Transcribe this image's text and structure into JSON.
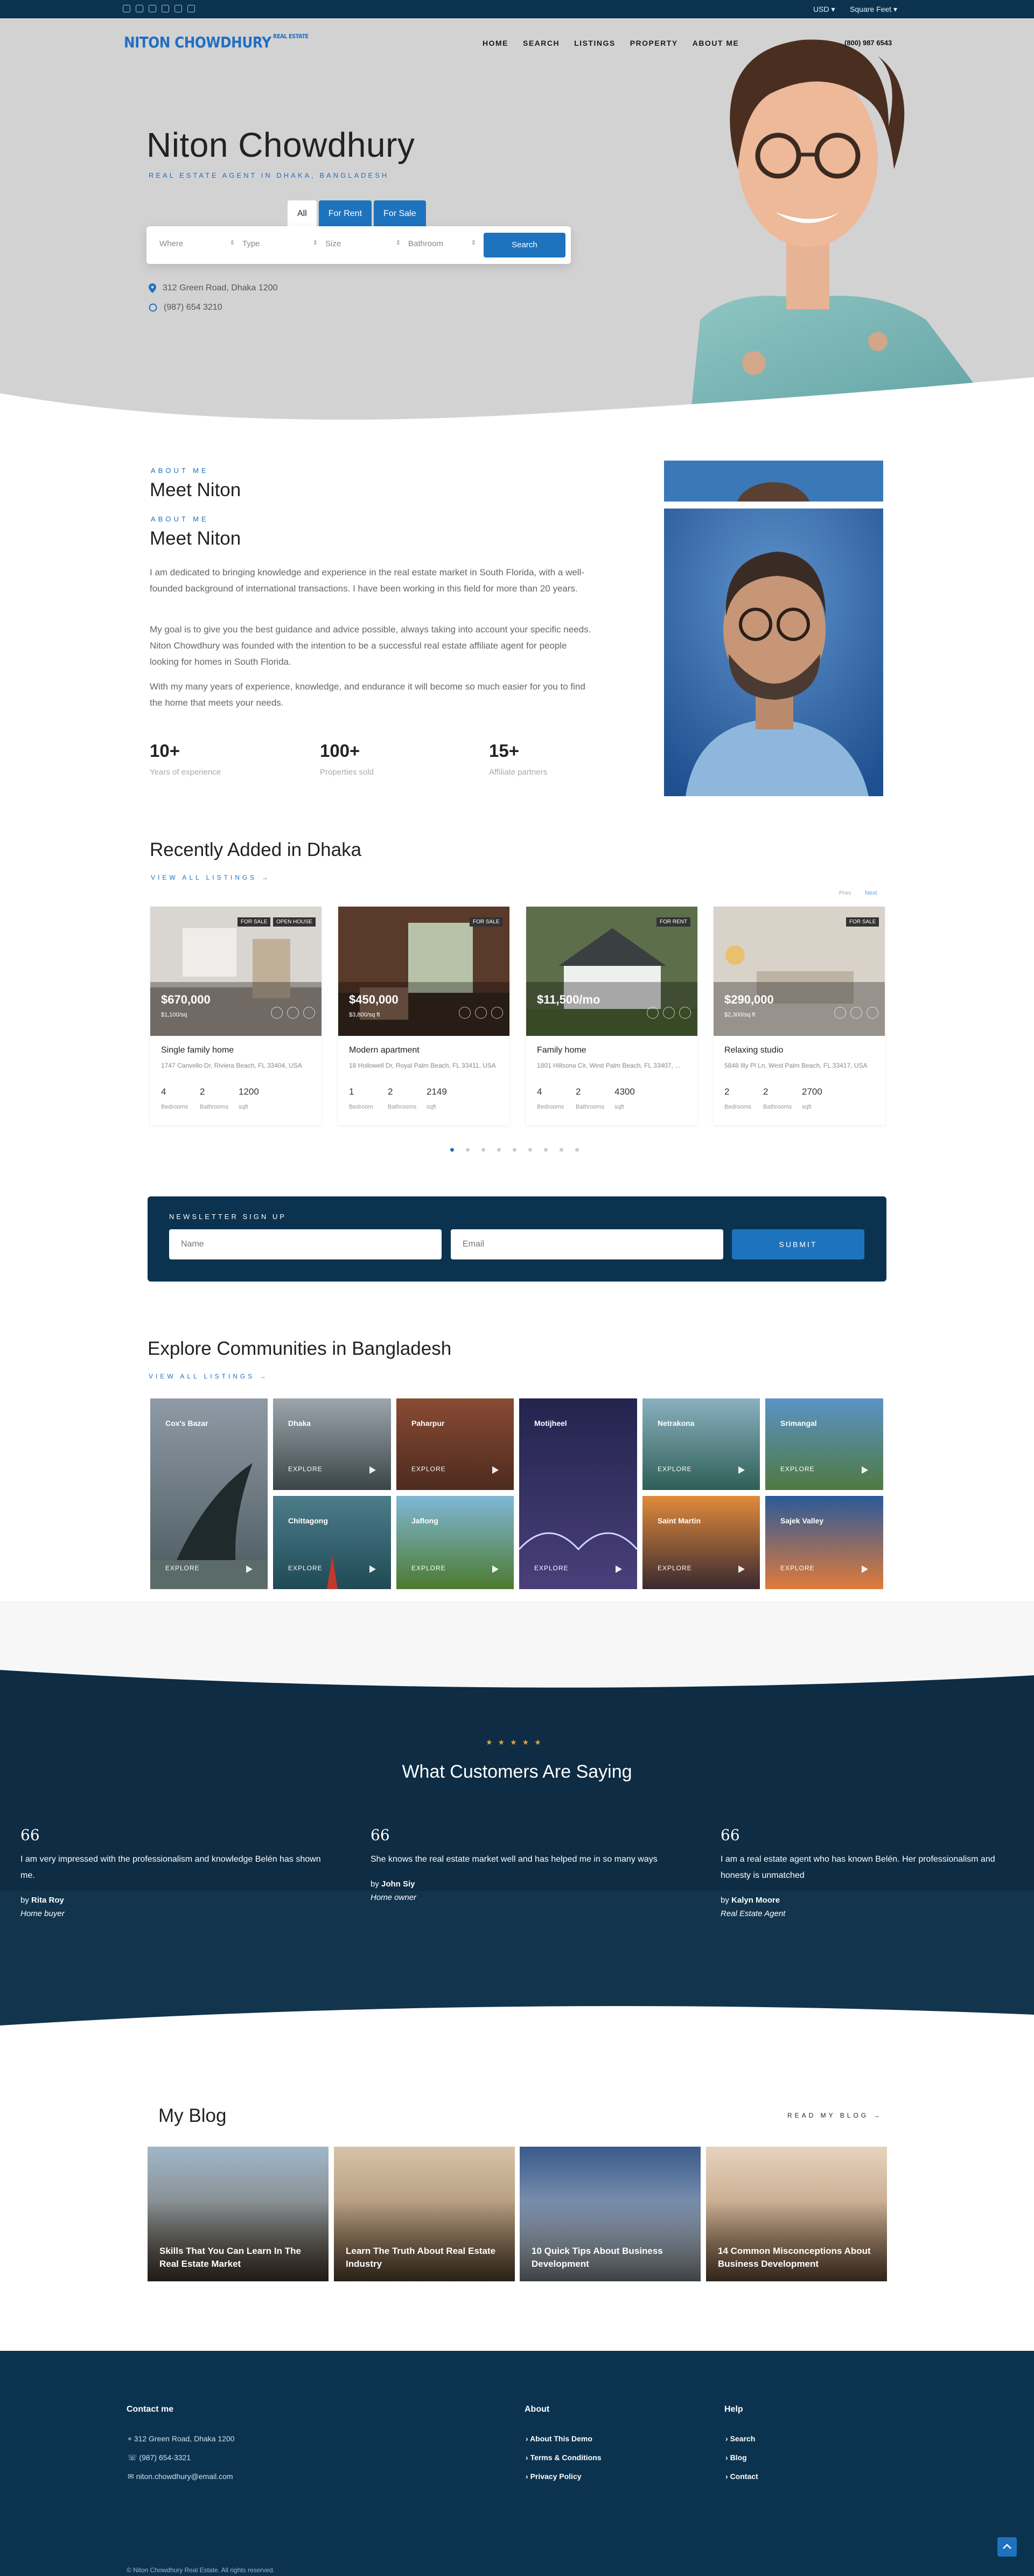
{
  "topbar": {
    "currency": "USD",
    "unit": "Square Feet"
  },
  "header": {
    "logo_text": "NITON CHOWDHURY",
    "logo_sub": "REAL ESTATE",
    "phone": "(800) 987 6543",
    "menu": [
      "HOME",
      "SEARCH",
      "LISTINGS",
      "PROPERTY",
      "ABOUT ME"
    ]
  },
  "hero": {
    "name": "Niton Chowdhury",
    "subtitle": "REAL ESTATE AGENT IN DHAKA, BANGLADESH",
    "tabs": [
      "All",
      "For Rent",
      "For Sale"
    ],
    "fields": [
      "Where",
      "Type",
      "Size",
      "Bathroom"
    ],
    "search_label": "Search",
    "address": "312 Green Road, Dhaka 1200",
    "phone": "(987) 654 3210"
  },
  "about": {
    "eyebrow": "ABOUT ME",
    "title": "Meet Niton",
    "p1": "I am dedicated to bringing knowledge and experience in the real estate market in South Florida, with a well-founded background of international transactions. I have been working in this field for more than 20 years.",
    "p2": "My goal is to give you the best guidance and advice possible, always taking into account your specific needs. Niton Chowdhury was founded with the intention to be a successful real estate affiliate agent for people looking for homes in South Florida.",
    "p3": "With my many years of experience, knowledge, and endurance it will become so much easier for you to find the home that meets your needs.",
    "stats": [
      {
        "value": "10+",
        "label": "Years of experience"
      },
      {
        "value": "100+",
        "label": "Properties sold"
      },
      {
        "value": "15+",
        "label": "Affiliate partners"
      }
    ]
  },
  "listings": {
    "title": "Recently Added in Dhaka",
    "view_all": "VIEW ALL LISTINGS →",
    "prev": "Prev",
    "next": "Next",
    "cards": [
      {
        "tags": [
          "FOR SALE",
          "OPEN HOUSE"
        ],
        "price": "$670,000",
        "pps": "$1,100/sq",
        "title": "Single family home",
        "address": "1747 Canvello Dr, Riviera Beach, FL 33404, USA",
        "beds": "4",
        "baths": "2",
        "sqft": "1200",
        "l1": "Bedrooms",
        "l2": "Bathrooms",
        "l3": "sqft"
      },
      {
        "tags": [
          "FOR SALE"
        ],
        "price": "$450,000",
        "pps": "$3,800/sq ft",
        "title": "Modern apartment",
        "address": "18 Hollowell Dr, Royal Palm Beach, FL 33411, USA",
        "beds": "1",
        "baths": "2",
        "sqft": "2149",
        "l1": "Bedroom",
        "l2": "Bathrooms",
        "l3": "sqft"
      },
      {
        "tags": [
          "FOR RENT"
        ],
        "price": "$11,500/mo",
        "pps": "",
        "title": "Family home",
        "address": "1801 Hillsona Cir, West Palm Beach, FL 33407, ...",
        "beds": "4",
        "baths": "2",
        "sqft": "4300",
        "l1": "Bedrooms",
        "l2": "Bathrooms",
        "l3": "sqft"
      },
      {
        "tags": [
          "FOR SALE"
        ],
        "price": "$290,000",
        "pps": "$2,300/sq ft",
        "title": "Relaxing studio",
        "address": "5848 Illy Pl Ln, West Palm Beach, FL 33417, USA",
        "beds": "2",
        "baths": "2",
        "sqft": "2700",
        "l1": "Bedrooms",
        "l2": "Bathrooms",
        "l3": "sqft"
      }
    ]
  },
  "newsletter": {
    "label": "NEWSLETTER SIGN UP",
    "name_ph": "Name",
    "email_ph": "Email",
    "submit": "SUBMIT"
  },
  "communities": {
    "title": "Explore Communities in Bangladesh",
    "view_all": "VIEW ALL LISTINGS →",
    "explore": "EXPLORE",
    "items": [
      "Cox's Bazar",
      "Dhaka",
      "Paharpur",
      "Motijheel",
      "Netrakona",
      "Srimangal",
      "Chittagong",
      "Jaflong",
      "Saint Martin",
      "Sajek Valley"
    ]
  },
  "testimonials": {
    "title": "What Customers Are Saying",
    "items": [
      {
        "text": "I am very impressed with the professionalism and knowledge Belén has shown me.",
        "by": "Rita Roy",
        "role": "Home buyer"
      },
      {
        "text": "She knows the real estate market well and has helped me in so many ways",
        "by": "John Siy",
        "role": "Home owner"
      },
      {
        "text": "I am a real estate agent who has known Belén. Her professionalism and honesty is unmatched",
        "by": "Kalyn Moore",
        "role": "Real Estate Agent"
      }
    ]
  },
  "blog": {
    "title": "My Blog",
    "read_more": "READ MY BLOG →",
    "posts": [
      "Skills That You Can Learn In The Real Estate Market",
      "Learn The Truth About Real Estate Industry",
      "10 Quick Tips About Business Development",
      "14 Common Misconceptions About Business Development"
    ]
  },
  "footer": {
    "contact_title": "Contact me",
    "address": "312 Green Road, Dhaka 1200",
    "phone": "(987) 654-3321",
    "email": "niton.chowdhury@email.com",
    "about_title": "About",
    "about_links": [
      "About This Demo",
      "Terms & Conditions",
      "Privacy Policy"
    ],
    "help_title": "Help",
    "help_links": [
      "Search",
      "Blog",
      "Contact"
    ],
    "copyright": "© Niton Chowdhury Real Estate. All rights reserved."
  },
  "colors": {
    "primary": "#1e73be",
    "navy": "#0b3350"
  }
}
